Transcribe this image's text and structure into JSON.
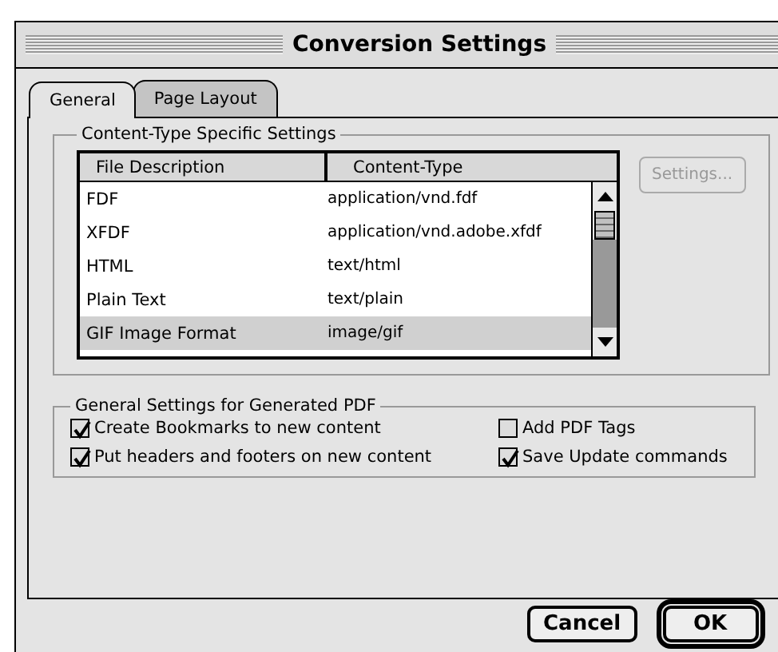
{
  "window": {
    "title": "Conversion Settings"
  },
  "tabs": [
    {
      "label": "General",
      "selected": true
    },
    {
      "label": "Page Layout",
      "selected": false
    }
  ],
  "content_type_group": {
    "title": "Content-Type Specific Settings",
    "columns": [
      "File Description",
      "Content-Type"
    ],
    "rows": [
      {
        "description": "FDF",
        "content_type": "application/vnd.fdf",
        "selected": false
      },
      {
        "description": "XFDF",
        "content_type": "application/vnd.adobe.xfdf",
        "selected": false
      },
      {
        "description": "HTML",
        "content_type": "text/html",
        "selected": false
      },
      {
        "description": "Plain Text",
        "content_type": "text/plain",
        "selected": false
      },
      {
        "description": "GIF Image Format",
        "content_type": "image/gif",
        "selected": true
      }
    ],
    "settings_button": {
      "label": "Settings...",
      "disabled": true
    }
  },
  "general_group": {
    "title": "General Settings for Generated PDF",
    "options": [
      {
        "label": "Create Bookmarks to new content",
        "checked": true
      },
      {
        "label": "Add PDF Tags",
        "checked": false
      },
      {
        "label": "Put headers and footers on new content",
        "checked": true
      },
      {
        "label": "Save Update commands",
        "checked": true
      }
    ]
  },
  "buttons": [
    {
      "label": "Cancel",
      "default": false
    },
    {
      "label": "OK",
      "default": true
    }
  ]
}
